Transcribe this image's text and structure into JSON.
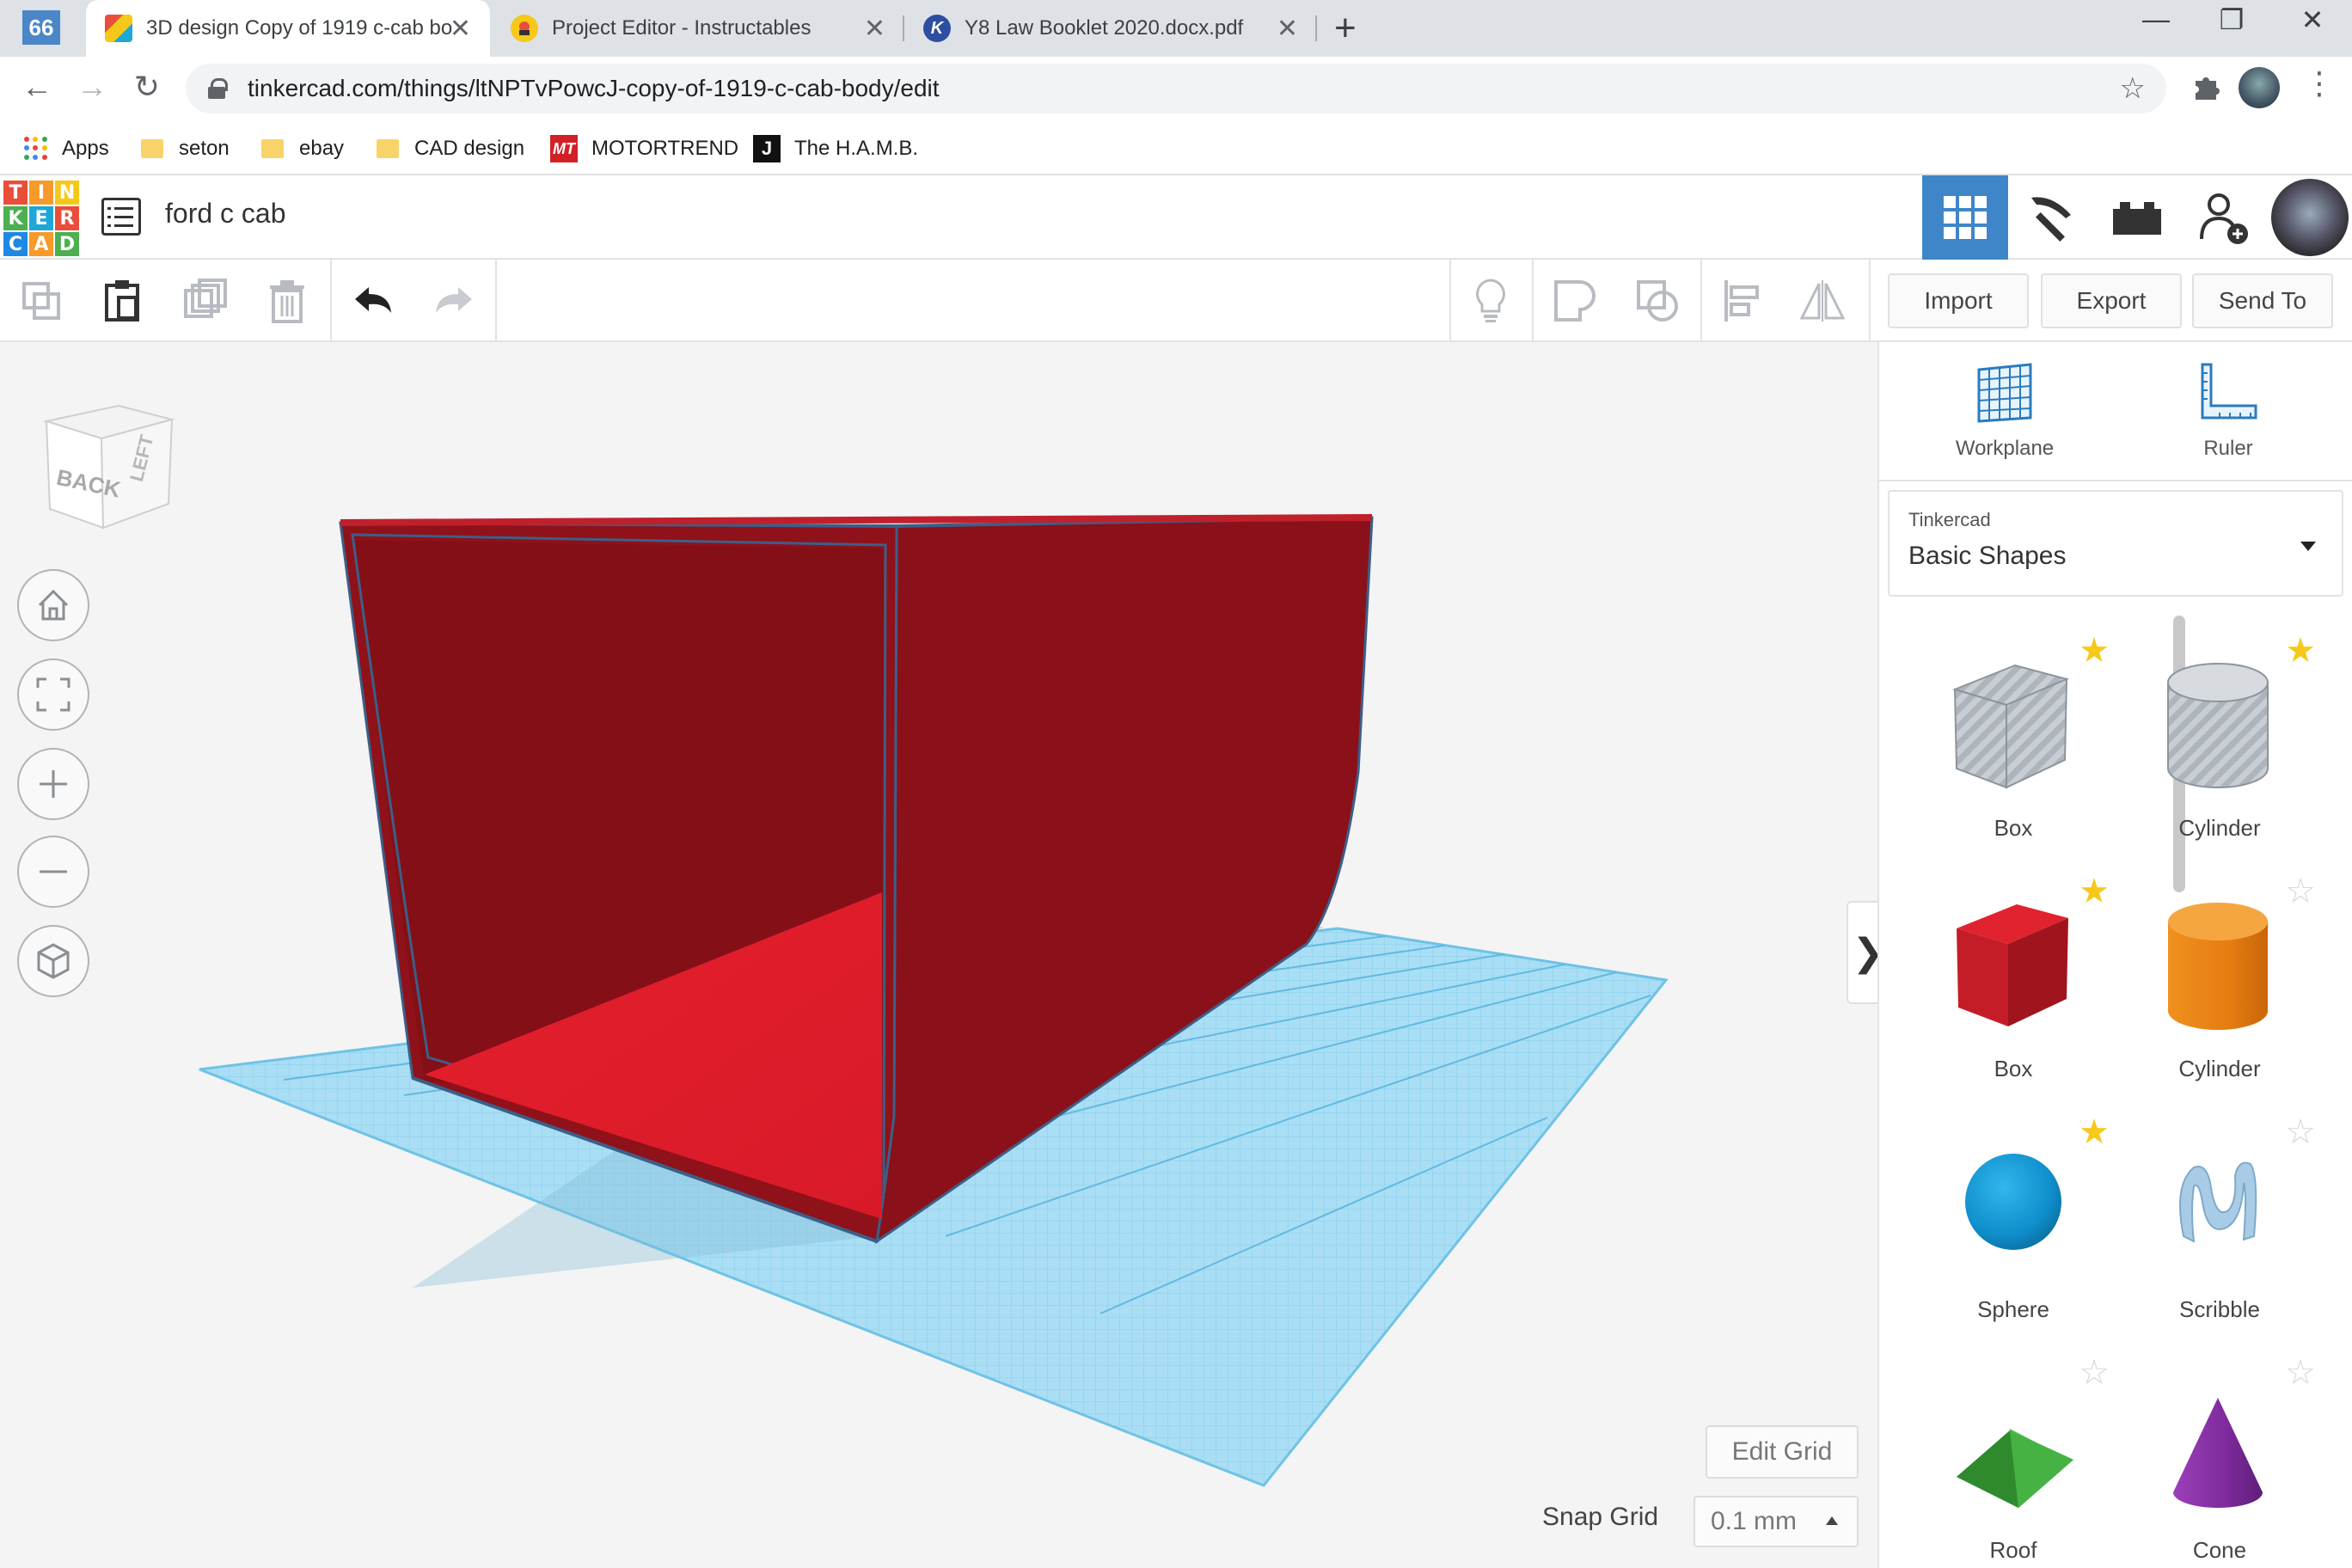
{
  "browser": {
    "site_badge": "66",
    "tabs": [
      {
        "title": "3D design Copy of 1919 c-cab bo",
        "close": "✕"
      },
      {
        "title": "Project Editor - Instructables",
        "close": "✕"
      },
      {
        "title": "Y8 Law Booklet 2020.docx.pdf",
        "close": "✕",
        "icon_letter": "K"
      }
    ],
    "new_tab": "+",
    "window": {
      "minimize": "—",
      "restore": "❐",
      "close": "✕"
    },
    "url": "tinkercad.com/things/ltNPTvPowcJ-copy-of-1919-c-cab-body/edit",
    "bookmarks": [
      {
        "label": "Apps",
        "icon": "apps-grid-icon"
      },
      {
        "label": "seton",
        "icon": "folder-icon"
      },
      {
        "label": "ebay",
        "icon": "folder-icon"
      },
      {
        "label": "CAD design",
        "icon": "folder-icon"
      },
      {
        "label": "MOTORTREND",
        "icon": "motortrend-icon",
        "badge": "MT"
      },
      {
        "label": "The H.A.M.B.",
        "icon": "hamb-icon",
        "badge": "J"
      }
    ]
  },
  "tinkercad": {
    "logo_letters": [
      "T",
      "I",
      "N",
      "K",
      "E",
      "R",
      "C",
      "A",
      "D"
    ],
    "logo_colors": [
      "#e94e3a",
      "#f79a2a",
      "#f6c81a",
      "#4caf50",
      "#1ea7d8",
      "#e94e3a",
      "#1e88e5",
      "#f79a2a",
      "#4caf50"
    ],
    "design_name": "ford c cab",
    "header_buttons": [
      "3d-view-icon",
      "codeblocks-pickaxe-icon",
      "bricks-icon",
      "add-user-icon"
    ],
    "accent_color": "#3f86c9"
  },
  "toolbar": {
    "import_label": "Import",
    "export_label": "Export",
    "send_to_label": "Send To"
  },
  "viewcube": {
    "back": "BACK",
    "left": "LEFT"
  },
  "workspace": {
    "edit_grid_label": "Edit Grid",
    "snap_grid_label": "Snap Grid",
    "snap_grid_value": "0.1 mm",
    "collapse_arrow": "❯",
    "shape_color": "#b5121b",
    "workplane_color": "#8fd3f0"
  },
  "panel": {
    "workplane_label": "Workplane",
    "ruler_label": "Ruler",
    "library_source": "Tinkercad",
    "library_name": "Basic Shapes",
    "shapes": [
      {
        "label": "Box",
        "style": "hole",
        "favorite": true
      },
      {
        "label": "Cylinder",
        "style": "hole",
        "favorite": true
      },
      {
        "label": "Box",
        "style": "solid-red",
        "favorite": true
      },
      {
        "label": "Cylinder",
        "style": "solid-orange",
        "favorite": false
      },
      {
        "label": "Sphere",
        "style": "solid-blue",
        "favorite": true
      },
      {
        "label": "Scribble",
        "style": "scribble",
        "favorite": false
      },
      {
        "label": "Roof",
        "style": "solid-green",
        "favorite": false
      },
      {
        "label": "Cone",
        "style": "solid-purple",
        "favorite": false
      }
    ]
  }
}
